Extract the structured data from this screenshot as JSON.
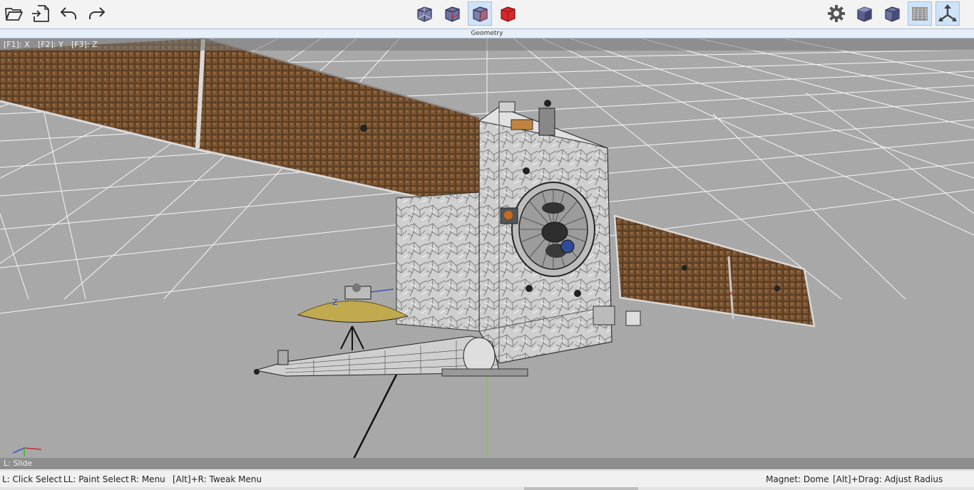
{
  "toolbar": {
    "left_buttons": [
      {
        "icon": "open-folder-icon"
      },
      {
        "icon": "import-icon"
      },
      {
        "icon": "undo-icon"
      },
      {
        "icon": "redo-icon"
      }
    ],
    "view_modes": [
      {
        "icon": "wireframe-cube-icon",
        "active": false
      },
      {
        "icon": "smooth-wire-cube-icon",
        "active": false
      },
      {
        "icon": "shaded-wire-cube-icon",
        "active": true
      },
      {
        "icon": "solid-red-cube-icon",
        "active": false
      }
    ],
    "right_buttons": [
      {
        "icon": "settings-gear-icon",
        "active": false
      },
      {
        "icon": "solid-cube-icon",
        "active": false
      },
      {
        "icon": "wire-cube-icon",
        "active": false
      },
      {
        "icon": "grid-floor-icon",
        "active": true
      },
      {
        "icon": "axes-icon",
        "active": true
      }
    ],
    "mode_label": "Geometry"
  },
  "viewport": {
    "hints": [
      "[F1]: X",
      "[F2]: Y",
      "[F3]: Z"
    ],
    "mouse_hint": "L: Slide",
    "background_color": "#a8a8a8",
    "grid_color": "#ffffff",
    "solar_panel_color": "#5b3e22",
    "foil_color": "#d4d4d4"
  },
  "statusbar": {
    "left": [
      "L: Click Select",
      "LL: Paint Select",
      "R: Menu",
      "[Alt]+R: Tweak Menu"
    ],
    "right": [
      "Magnet: Dome",
      "[Alt]+Drag: Adjust Radius"
    ]
  }
}
